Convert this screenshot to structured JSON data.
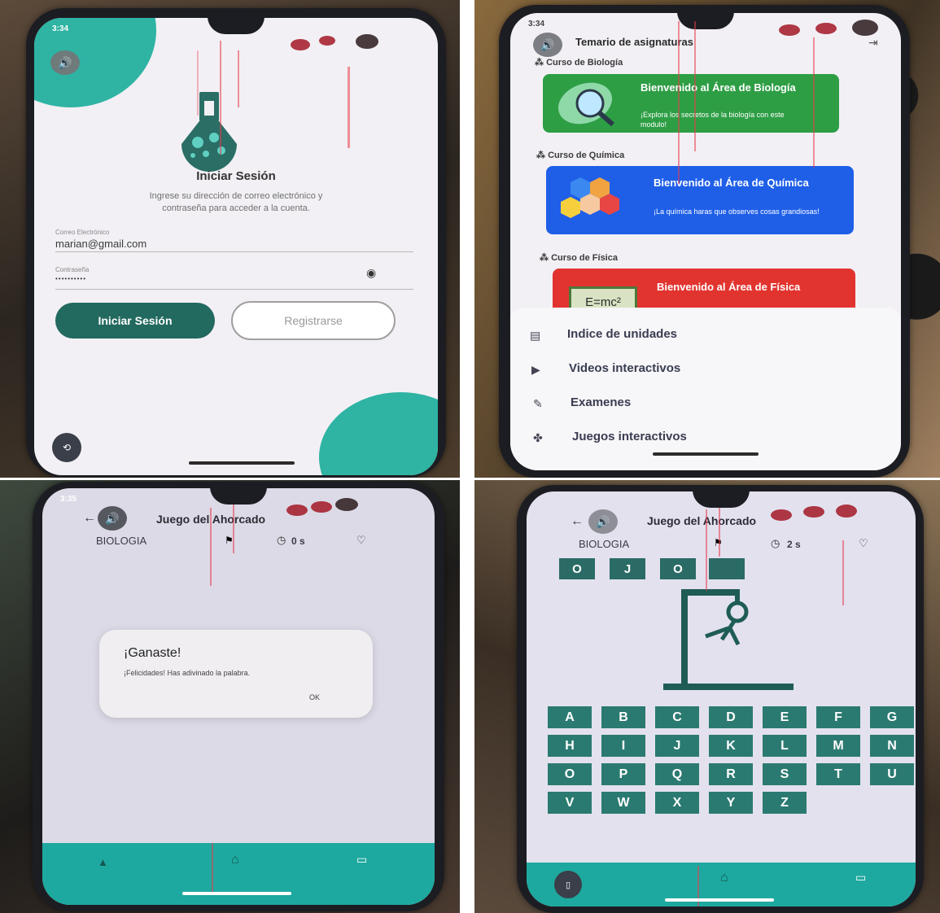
{
  "colors": {
    "teal_dark": "#22695f",
    "teal_bright": "#1ea9a0",
    "biology_card": "#2e9e45",
    "chemistry_card": "#1f5fe8",
    "physics_card": "#e2342f",
    "key": "#2b7a71"
  },
  "login": {
    "status_time": "3:34",
    "volume_icon": "speaker-icon",
    "title": "Iniciar Sesión",
    "subtitle_line1": "Ingrese su dirección de correo electrónico y",
    "subtitle_line2": "contraseña para acceder a la cuenta.",
    "email_label": "Correo Electrónico",
    "email_value": "marian@gmail.com",
    "password_label": "Contraseña",
    "password_value": "••••••••••",
    "login_button": "Iniciar Sesión",
    "register_button": "Registrarse"
  },
  "courses": {
    "status_time": "3:34",
    "title": "Temario de asignaturas",
    "sections": [
      {
        "label": "Curso de Biología",
        "card_title": "Bienvenido al Área de Biología",
        "card_desc": "¡Explora los secretos de la biología con este modulo!"
      },
      {
        "label": "Curso de Química",
        "card_title": "Bienvenido al Área de Química",
        "card_desc": "¡La química haras que observes cosas grandiosas!"
      },
      {
        "label": "Curso de Física",
        "card_title": "Bienvenido al Área de Física",
        "card_desc": ""
      }
    ],
    "physics_formula": "E=mc²",
    "menu": [
      {
        "label": "Indice de unidades",
        "icon": "book-icon"
      },
      {
        "label": "Videos interactivos",
        "icon": "play-icon"
      },
      {
        "label": "Examenes",
        "icon": "pencil-icon"
      },
      {
        "label": "Juegos interactivos",
        "icon": "gamepad-icon"
      }
    ]
  },
  "game_win": {
    "status_time": "3:35",
    "title": "Juego del Ahorcado",
    "category": "BIOLOGIA",
    "timer": "0 s",
    "dialog_title": "¡Ganaste!",
    "dialog_message": "¡Felicidades! Has adivinado la palabra.",
    "dialog_ok": "OK"
  },
  "game_play": {
    "title": "Juego del Ahorcado",
    "category": "BIOLOGIA",
    "timer": "2 s",
    "word_letters": [
      "O",
      "J",
      "O",
      ""
    ],
    "keyboard": [
      [
        "A",
        "B",
        "C",
        "D",
        "E",
        "F",
        "G"
      ],
      [
        "H",
        "I",
        "J",
        "K",
        "L",
        "M",
        "N"
      ],
      [
        "O",
        "P",
        "Q",
        "R",
        "S",
        "T",
        "U"
      ],
      [
        "V",
        "W",
        "X",
        "Y",
        "Z"
      ]
    ]
  }
}
